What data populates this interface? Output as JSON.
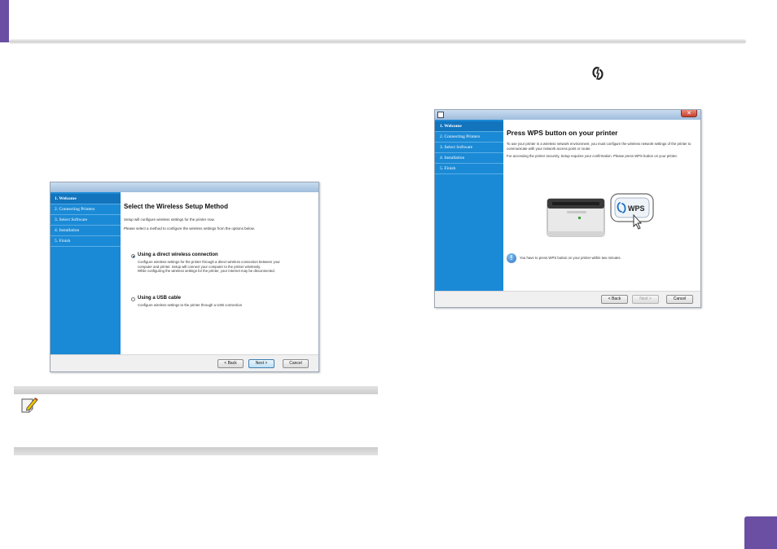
{
  "page": {
    "accent_color": "#6a4fa3"
  },
  "dialog1": {
    "sidebar_items": [
      {
        "label": "1. Welcome",
        "active": true
      },
      {
        "label": "2. Connecting Printers",
        "active": false
      },
      {
        "label": "3. Select Software",
        "active": false
      },
      {
        "label": "4. Installation",
        "active": false
      },
      {
        "label": "5. Finish",
        "active": false
      }
    ],
    "title": "Select the Wireless Setup Method",
    "intro": "Setup will configure wireless settings for the printer now.",
    "instruction": "Please select a method to configure the wireless settings from the options below.",
    "option_direct": {
      "label": "Using a direct wireless connection",
      "selected": true,
      "description_1": "Configure wireless settings for the printer through a direct wireless connection between your computer and printer. Setup will connect your computer to the printer wirelessly.",
      "description_2": "While configuring the wireless settings for the printer, your Internet may be disconnected."
    },
    "option_usb": {
      "label": "Using a USB cable",
      "selected": false,
      "description": "Configure wireless settings to the printer through a USB connection"
    },
    "buttons": {
      "back": "< Back",
      "next": "Next >",
      "cancel": "Cancel"
    }
  },
  "dialog2": {
    "sidebar_items": [
      {
        "label": "1. Welcome",
        "active": true
      },
      {
        "label": "2. Connecting Printers",
        "active": false
      },
      {
        "label": "3. Select Software",
        "active": false
      },
      {
        "label": "4. Installation",
        "active": false
      },
      {
        "label": "5. Finish",
        "active": false
      }
    ],
    "title": "Press WPS button on your printer",
    "paragraph_1": "To use your printer in a wireless network environment, you must configure the wireless network settings of the printer to communicate with your network access point or router.",
    "paragraph_2": "For accessing the printer securely, Setup requires your confirmation. Please press WPS button on your printer.",
    "wps_button_label": "WPS",
    "info_text": "You have to press WPS button on your printer within two minutes.",
    "buttons": {
      "back": "< Back",
      "next": "Next >",
      "next_enabled": false,
      "cancel": "Cancel"
    }
  },
  "note": {
    "icon": "note-pencil-icon"
  }
}
